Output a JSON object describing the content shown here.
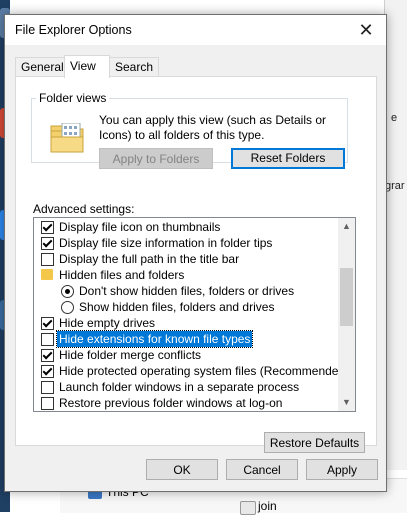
{
  "dialog": {
    "title": "File Explorer Options",
    "tabs": [
      "General",
      "View",
      "Search"
    ],
    "active_tab": "View"
  },
  "folder_views": {
    "legend": "Folder views",
    "description": "You can apply this view (such as Details or Icons) to all folders of this type.",
    "apply_button": "Apply to Folders",
    "reset_button": "Reset Folders"
  },
  "advanced": {
    "label": "Advanced settings:",
    "items": [
      {
        "kind": "checkbox",
        "checked": true,
        "indent": 0,
        "label": "Display file icon on thumbnails"
      },
      {
        "kind": "checkbox",
        "checked": true,
        "indent": 0,
        "label": "Display file size information in folder tips"
      },
      {
        "kind": "checkbox",
        "checked": false,
        "indent": 0,
        "label": "Display the full path in the title bar"
      },
      {
        "kind": "folder",
        "indent": 0,
        "label": "Hidden files and folders"
      },
      {
        "kind": "radio",
        "checked": true,
        "indent": 1,
        "label": "Don't show hidden files, folders or drives"
      },
      {
        "kind": "radio",
        "checked": false,
        "indent": 1,
        "label": "Show hidden files, folders and drives"
      },
      {
        "kind": "checkbox",
        "checked": true,
        "indent": 0,
        "label": "Hide empty drives"
      },
      {
        "kind": "checkbox",
        "checked": false,
        "indent": 0,
        "label": "Hide extensions for known file types",
        "highlighted": true
      },
      {
        "kind": "checkbox",
        "checked": true,
        "indent": 0,
        "label": "Hide folder merge conflicts"
      },
      {
        "kind": "checkbox",
        "checked": true,
        "indent": 0,
        "label": "Hide protected operating system files (Recommended)"
      },
      {
        "kind": "checkbox",
        "checked": false,
        "indent": 0,
        "label": "Launch folder windows in a separate process"
      },
      {
        "kind": "checkbox",
        "checked": false,
        "indent": 0,
        "label": "Restore previous folder windows at log-on"
      }
    ],
    "restore_defaults": "Restore Defaults"
  },
  "footer": {
    "ok": "OK",
    "cancel": "Cancel",
    "apply": "Apply"
  },
  "background": {
    "right_fragments": [
      "e",
      "grar"
    ],
    "bottom_items": [
      "This PC",
      "join"
    ]
  },
  "colors": {
    "accent": "#0078d7",
    "dialog_bg": "#f0f0f0",
    "folder_icon": "#f3c84a"
  }
}
